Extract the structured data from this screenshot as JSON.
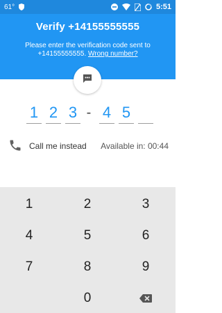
{
  "status_bar": {
    "temperature": "61°",
    "time": "5:51"
  },
  "header": {
    "title": "Verify +14155555555",
    "subtitle_line1": "Please enter the verification code sent to",
    "subtitle_line2": "+14155555555.",
    "wrong_number_link": "Wrong number?"
  },
  "code": {
    "digits": [
      "1",
      "2",
      "3",
      "4",
      "5",
      ""
    ],
    "separator": "-"
  },
  "call": {
    "label": "Call me instead",
    "available": "Available in: 00:44"
  },
  "keypad": {
    "keys": [
      "1",
      "2",
      "3",
      "4",
      "5",
      "6",
      "7",
      "8",
      "9",
      "0"
    ]
  },
  "colors": {
    "header": "#2196f3",
    "status_bar": "#1f88dd",
    "accent": "#2196f3",
    "keypad_bg": "#e8e8e8"
  }
}
